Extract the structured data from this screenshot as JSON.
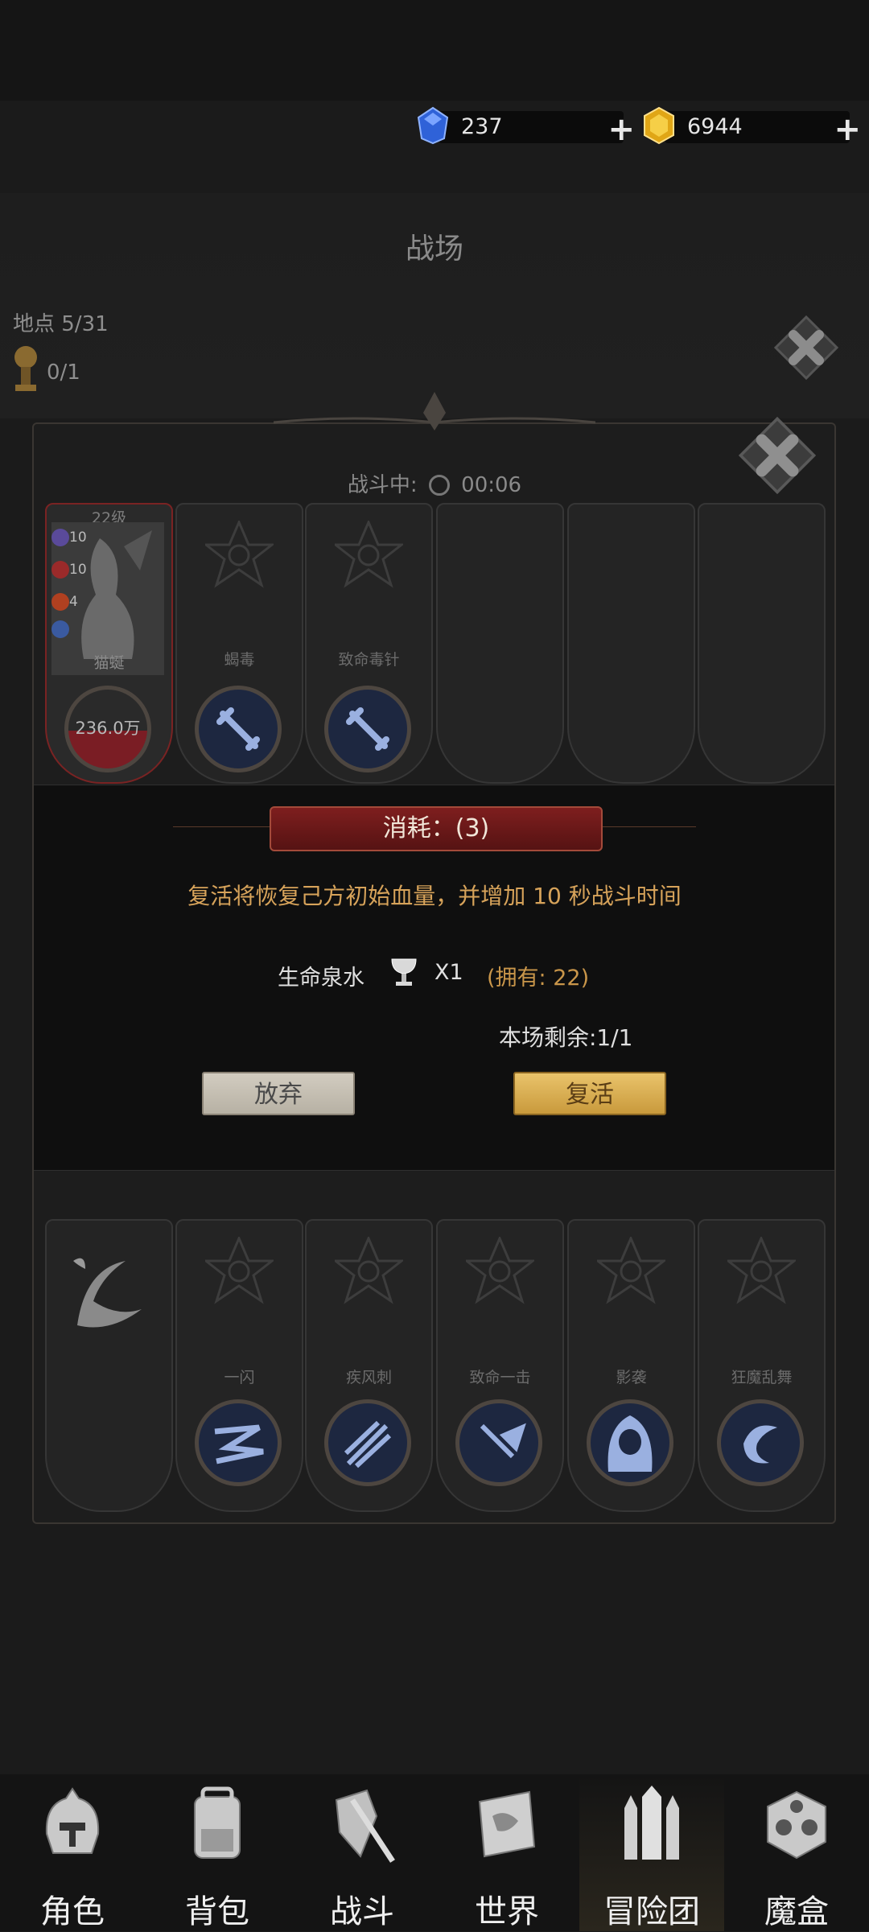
{
  "currencies": [
    {
      "name": "blue-gem",
      "value": "237",
      "color": "#3b6fe0"
    },
    {
      "name": "gold-gem",
      "value": "6944",
      "color": "#e6b020"
    }
  ],
  "page_title": "战场",
  "location": "地点 5/31",
  "counter": "0/1",
  "battle": {
    "status_label": "战斗中:",
    "timer": "00:06",
    "hero": {
      "level": "22级",
      "name": "猫蜒",
      "hp": "236.0万",
      "stats": [
        "10",
        "10",
        "4"
      ]
    },
    "top_slots": [
      {
        "label": "蝎毒",
        "icon": "dagger-icon"
      },
      {
        "label": "致命毒针",
        "icon": "dagger-icon"
      }
    ],
    "bottom_slots": [
      {
        "label": "一闪",
        "icon": "lightning-slash-icon"
      },
      {
        "label": "疾风刺",
        "icon": "triple-arrow-icon"
      },
      {
        "label": "致命一击",
        "icon": "critical-strike-icon"
      },
      {
        "label": "影袭",
        "icon": "hooded-shadow-icon"
      },
      {
        "label": "狂魔乱舞",
        "icon": "swirl-icon"
      }
    ]
  },
  "dialog": {
    "cost_title": "消耗：(3)",
    "description": "复活将恢复己方初始血量，并增加 10 秒战斗时间",
    "item_name": "生命泉水",
    "item_icon": "chalice-icon",
    "item_qty": "X1",
    "owned": "(拥有: 22)",
    "remaining": "本场剩余:1/1",
    "abandon_label": "放弃",
    "revive_label": "复活"
  },
  "nav": [
    {
      "label": "角色",
      "icon": "helmet-icon"
    },
    {
      "label": "背包",
      "icon": "backpack-icon"
    },
    {
      "label": "战斗",
      "icon": "shield-sword-icon"
    },
    {
      "label": "世界",
      "icon": "map-scroll-icon"
    },
    {
      "label": "冒险团",
      "icon": "castle-icon",
      "active": true
    },
    {
      "label": "魔盒",
      "icon": "cube-icon"
    }
  ]
}
